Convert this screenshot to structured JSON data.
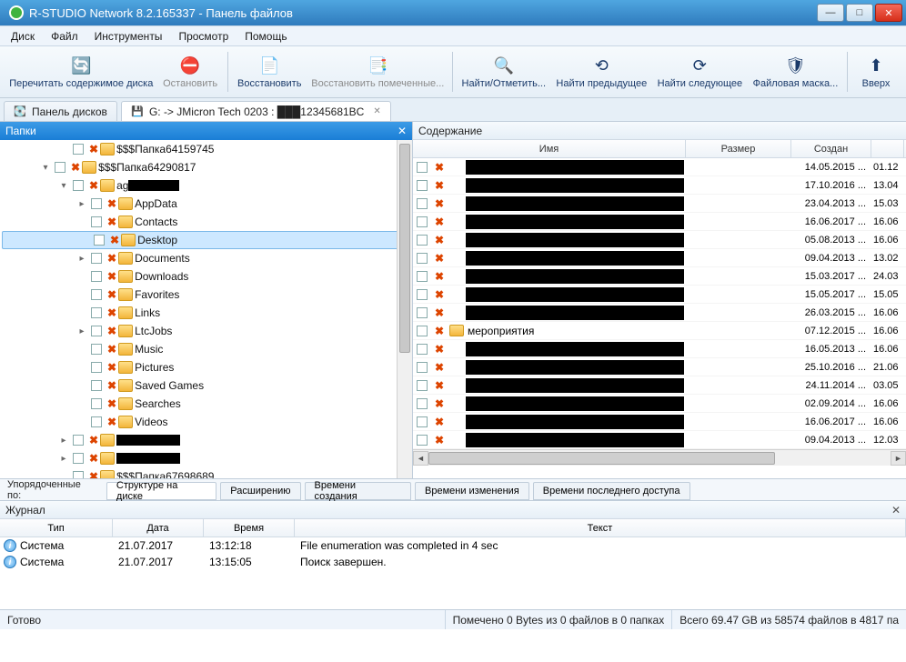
{
  "title": "R-STUDIO Network 8.2.165337 - Панель файлов",
  "menu": [
    "Диск",
    "Файл",
    "Инструменты",
    "Просмотр",
    "Помощь"
  ],
  "toolbar": [
    {
      "id": "reread",
      "label": "Перечитать содержимое диска",
      "icon": "🔄",
      "disabled": false
    },
    {
      "id": "stop",
      "label": "Остановить",
      "icon": "⛔",
      "disabled": true
    },
    {
      "id": "recover",
      "label": "Восстановить",
      "icon": "📄",
      "disabled": false
    },
    {
      "id": "recover-marked",
      "label": "Восстановить помеченные...",
      "icon": "📑",
      "disabled": true
    },
    {
      "id": "find",
      "label": "Найти/Отметить...",
      "icon": "🔍",
      "disabled": false
    },
    {
      "id": "find-prev",
      "label": "Найти предыдущее",
      "icon": "⟲",
      "disabled": false
    },
    {
      "id": "find-next",
      "label": "Найти следующее",
      "icon": "⟳",
      "disabled": false
    },
    {
      "id": "mask",
      "label": "Файловая маска...",
      "icon": "🛡",
      "disabled": false
    },
    {
      "id": "up",
      "label": "Вверх",
      "icon": "⬆",
      "disabled": false
    }
  ],
  "tabs": {
    "diskpanel": "Панель дисков",
    "drive": "G: -> JMicron Tech 0203 : ███12345681BC"
  },
  "folders": {
    "title": "Папки",
    "items": [
      {
        "indent": 3,
        "exp": "",
        "label": "$$$Папка64159745",
        "sel": false
      },
      {
        "indent": 2,
        "exp": "▾",
        "label": "$$$Папка64290817",
        "sel": false
      },
      {
        "indent": 3,
        "exp": "▾",
        "label": "ag",
        "redact": 56,
        "sel": false,
        "noChk": false
      },
      {
        "indent": 4,
        "exp": "▸",
        "label": "AppData",
        "sel": false
      },
      {
        "indent": 4,
        "exp": "",
        "label": "Contacts",
        "sel": false
      },
      {
        "indent": 4,
        "exp": "",
        "label": "Desktop",
        "sel": true
      },
      {
        "indent": 4,
        "exp": "▸",
        "label": "Documents",
        "sel": false
      },
      {
        "indent": 4,
        "exp": "",
        "label": "Downloads",
        "sel": false
      },
      {
        "indent": 4,
        "exp": "",
        "label": "Favorites",
        "sel": false
      },
      {
        "indent": 4,
        "exp": "",
        "label": "Links",
        "sel": false
      },
      {
        "indent": 4,
        "exp": "▸",
        "label": "LtcJobs",
        "sel": false
      },
      {
        "indent": 4,
        "exp": "",
        "label": "Music",
        "sel": false
      },
      {
        "indent": 4,
        "exp": "",
        "label": "Pictures",
        "sel": false
      },
      {
        "indent": 4,
        "exp": "",
        "label": "Saved Games",
        "sel": false
      },
      {
        "indent": 4,
        "exp": "",
        "label": "Searches",
        "sel": false
      },
      {
        "indent": 4,
        "exp": "",
        "label": "Videos",
        "sel": false
      },
      {
        "indent": 3,
        "exp": "▸",
        "label": "",
        "redact": 70,
        "sel": false
      },
      {
        "indent": 3,
        "exp": "▸",
        "label": "",
        "redact": 70,
        "sel": false
      },
      {
        "indent": 3,
        "exp": "",
        "label": "$$$Папка67698689",
        "sel": false
      }
    ]
  },
  "contents": {
    "title": "Содержание",
    "cols": {
      "name": "Имя",
      "size": "Размер",
      "created": "Создан"
    },
    "rows": [
      {
        "date": "14.05.2015 ...",
        "ex": "01.12",
        "redact": true,
        "big": true
      },
      {
        "date": "17.10.2016 ...",
        "ex": "13.04",
        "redact": true
      },
      {
        "date": "23.04.2013 ...",
        "ex": "15.03",
        "redact": true
      },
      {
        "date": "16.06.2017 ...",
        "ex": "16.06",
        "redact": true
      },
      {
        "date": "05.08.2013 ...",
        "ex": "16.06",
        "redact": true
      },
      {
        "date": "09.04.2013 ...",
        "ex": "13.02",
        "redact": true
      },
      {
        "date": "15.03.2017 ...",
        "ex": "24.03",
        "redact": true
      },
      {
        "date": "15.05.2017 ...",
        "ex": "15.05",
        "redact": true
      },
      {
        "date": "26.03.2015 ...",
        "ex": "16.06",
        "redact": true
      },
      {
        "name": "мероприятия",
        "date": "07.12.2015 ...",
        "ex": "16.06",
        "redact": false
      },
      {
        "date": "16.05.2013 ...",
        "ex": "16.06",
        "redact": true,
        "big": true
      },
      {
        "date": "25.10.2016 ...",
        "ex": "21.06",
        "redact": true
      },
      {
        "date": "24.11.2014 ...",
        "ex": "03.05",
        "redact": true
      },
      {
        "date": "02.09.2014 ...",
        "ex": "16.06",
        "redact": true
      },
      {
        "date": "16.06.2017 ...",
        "ex": "16.06",
        "redact": true
      },
      {
        "date": "09.04.2013 ...",
        "ex": "12.03",
        "redact": true
      }
    ]
  },
  "sort": {
    "label": "Упорядоченные по:",
    "left": [
      "Структуре на диске",
      "Расширению",
      "Времени создания"
    ],
    "right": [
      "Времени изменения",
      "Времени последнего доступа"
    ]
  },
  "journal": {
    "title": "Журнал",
    "cols": {
      "type": "Тип",
      "date": "Дата",
      "time": "Время",
      "text": "Текст"
    },
    "rows": [
      {
        "type": "Система",
        "date": "21.07.2017",
        "time": "13:12:18",
        "text": "File enumeration was completed in 4 sec"
      },
      {
        "type": "Система",
        "date": "21.07.2017",
        "time": "13:15:05",
        "text": "Поиск завершен."
      }
    ]
  },
  "status": {
    "ready": "Готово",
    "marked": "Помечено 0 Bytes из 0 файлов в 0 папках",
    "total": "Всего 69.47 GB из 58574 файлов в 4817 па"
  }
}
